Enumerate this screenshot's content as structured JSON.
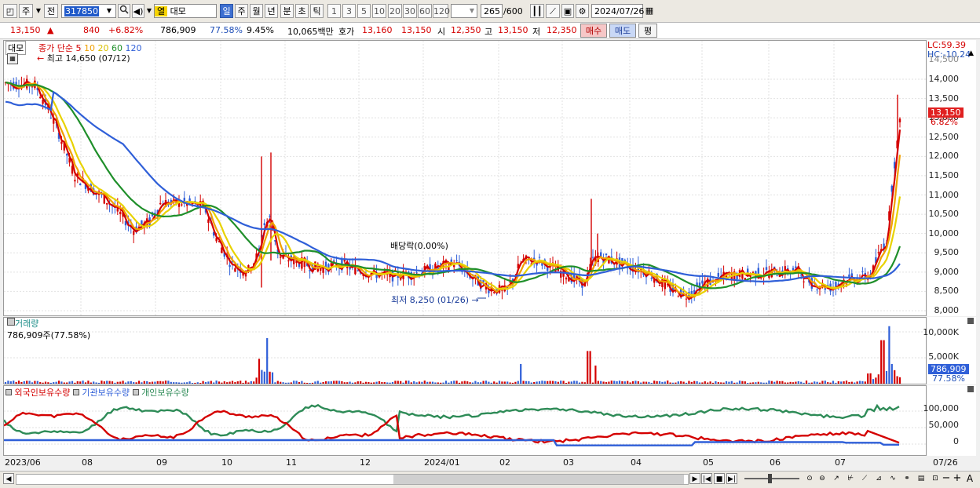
{
  "toolbar": {
    "type_code": "주",
    "type_mode": "전",
    "stock_code": "317850",
    "stock_name_tag": "열",
    "stock_name": "대모",
    "periods": [
      "일",
      "주",
      "월",
      "년",
      "분",
      "초",
      "틱"
    ],
    "active_period": "일",
    "intervals": [
      "1",
      "3",
      "5",
      "10",
      "20",
      "30",
      "60",
      "120"
    ],
    "count": "265",
    "count_total": "/600",
    "date": "2024/07/26"
  },
  "quote": {
    "price": "13,150",
    "change_arrow": "▲",
    "change": "840",
    "change_pct": "+6.82%",
    "volume": "786,909",
    "volume_ratio": "77.58%",
    "turnover_pct": "9.45%",
    "amount": "10,065백만",
    "bid_label": "호가",
    "bid1": "13,160",
    "bid2": "13,150",
    "open_label": "시",
    "open": "12,350",
    "high_label": "고",
    "high": "13,150",
    "low_label": "저",
    "low": "12,350",
    "buy_button": "매수",
    "sell_button": "매도",
    "eval_button": "평"
  },
  "price_panel": {
    "name_tag": "대모",
    "legend_title": "종가 단순",
    "ma_periods": [
      "5",
      "10",
      "20",
      "60",
      "120"
    ],
    "ma_colors": [
      "#d40000",
      "#f0a000",
      "#e8d200",
      "#1f8f2a",
      "#2f5fd8"
    ],
    "high_marker": "최고 14,650 (07/12)",
    "low_marker": "최저 8,250 (01/26)",
    "dividend_marker": "배당락(0.00%)",
    "lc": "LC:59.39",
    "hc": "HC:-10.24",
    "last_price_tag": "13,150",
    "last_pct_tag": "6.82%",
    "y_ticks": [
      "14,000",
      "13,500",
      "13,000",
      "12,500",
      "12,000",
      "11,500",
      "11,000",
      "10,500",
      "10,000",
      "9,500",
      "9,000",
      "8,500",
      "8,000"
    ],
    "y_top_clip": "14,500"
  },
  "volume_panel": {
    "title": "거래량",
    "value_label": "786,909주(77.58%)",
    "y_ticks": [
      "10,000K",
      "5,000K"
    ],
    "last_tag": "786,909",
    "last_pct": "77.58%"
  },
  "holdings_panel": {
    "series": [
      {
        "name": "외국인보유수량",
        "color": "#d40000"
      },
      {
        "name": "기관보유수량",
        "color": "#2f5fd8"
      },
      {
        "name": "개인보유수량",
        "color": "#2e8b57"
      }
    ],
    "y_ticks": [
      "100,000",
      "50,000",
      "0"
    ]
  },
  "x_axis": {
    "labels": [
      "2023/06",
      "08",
      "09",
      "10",
      "11",
      "12",
      "2024/01",
      "02",
      "03",
      "04",
      "05",
      "06",
      "07"
    ],
    "last_label": "07/26"
  },
  "icons": [
    "chart-type-icon",
    "search-icon",
    "speaker-icon",
    "calendar-icon",
    "candle-icon",
    "draw-icon",
    "save-icon",
    "gear-icon",
    "menu-icon"
  ],
  "scroll": {
    "zoom_minus": "−",
    "zoom_plus": "+",
    "font_a": "A"
  }
}
